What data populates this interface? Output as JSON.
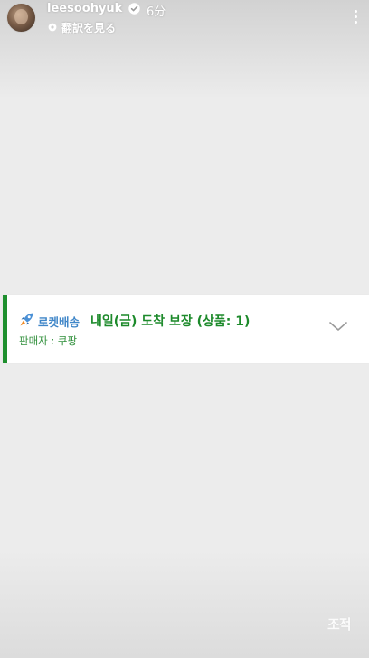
{
  "header": {
    "username": "leesoohyuk",
    "time_ago": "6分",
    "translate_label": "翻訳を見る"
  },
  "card": {
    "rocket_label": "로켓배송",
    "arrival_text": "내일(금) 도착 보장 (상품: 1)",
    "seller_text": "판매자 : 쿠팡"
  },
  "colors": {
    "accent_green": "#1d8a2b",
    "rocket_blue": "#3f86c8",
    "verified_blue": "#3897f0"
  }
}
